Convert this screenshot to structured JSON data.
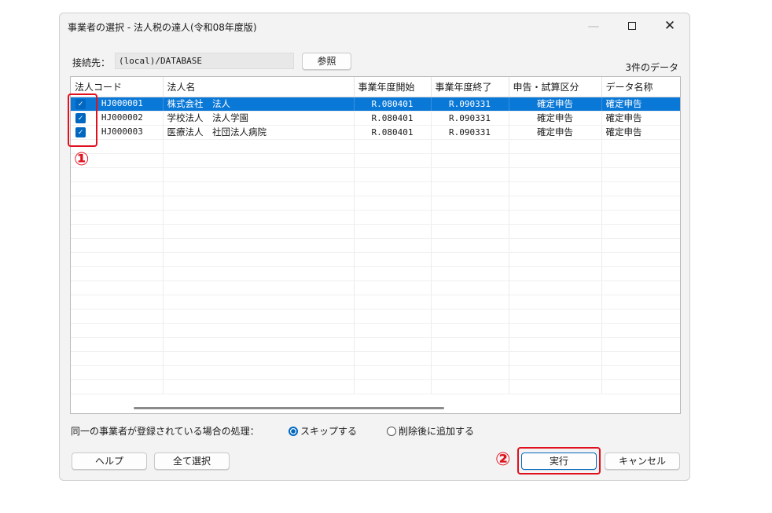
{
  "window": {
    "title": "事業者の選択 - 法人税の達人(令和08年度版)",
    "min_icon": "—",
    "max_icon": "□",
    "close_icon": "✕"
  },
  "connection": {
    "label": "接続先：",
    "value": "(local)/DATABASE",
    "browse_label": "参照"
  },
  "record_count": "3件のデータ",
  "table": {
    "columns": [
      "法人コード",
      "法人名",
      "事業年度開始",
      "事業年度終了",
      "申告・試算区分",
      "データ名称"
    ],
    "rows": [
      {
        "checked": true,
        "code": "HJ000001",
        "name": "株式会社　法人",
        "start": "R.080401",
        "end": "R.090331",
        "kind": "確定申告",
        "data_name": "確定申告",
        "selected": true
      },
      {
        "checked": true,
        "code": "HJ000002",
        "name": "学校法人　法人学園",
        "start": "R.080401",
        "end": "R.090331",
        "kind": "確定申告",
        "data_name": "確定申告",
        "selected": false
      },
      {
        "checked": true,
        "code": "HJ000003",
        "name": "医療法人　社団法人病院",
        "start": "R.080401",
        "end": "R.090331",
        "kind": "確定申告",
        "data_name": "確定申告",
        "selected": false
      }
    ]
  },
  "duplicate": {
    "label": "同一の事業者が登録されている場合の処理：",
    "options": [
      {
        "label": "スキップする",
        "selected": true
      },
      {
        "label": "削除後に追加する",
        "selected": false
      }
    ]
  },
  "buttons": {
    "help": "ヘルプ",
    "select_all": "全て選択",
    "execute": "実行",
    "cancel": "キャンセル"
  },
  "annotations": {
    "one": "①",
    "two": "②"
  },
  "colors": {
    "selection": "#0a78d7",
    "checkbox": "#0067c0",
    "callout": "#e0101e"
  }
}
